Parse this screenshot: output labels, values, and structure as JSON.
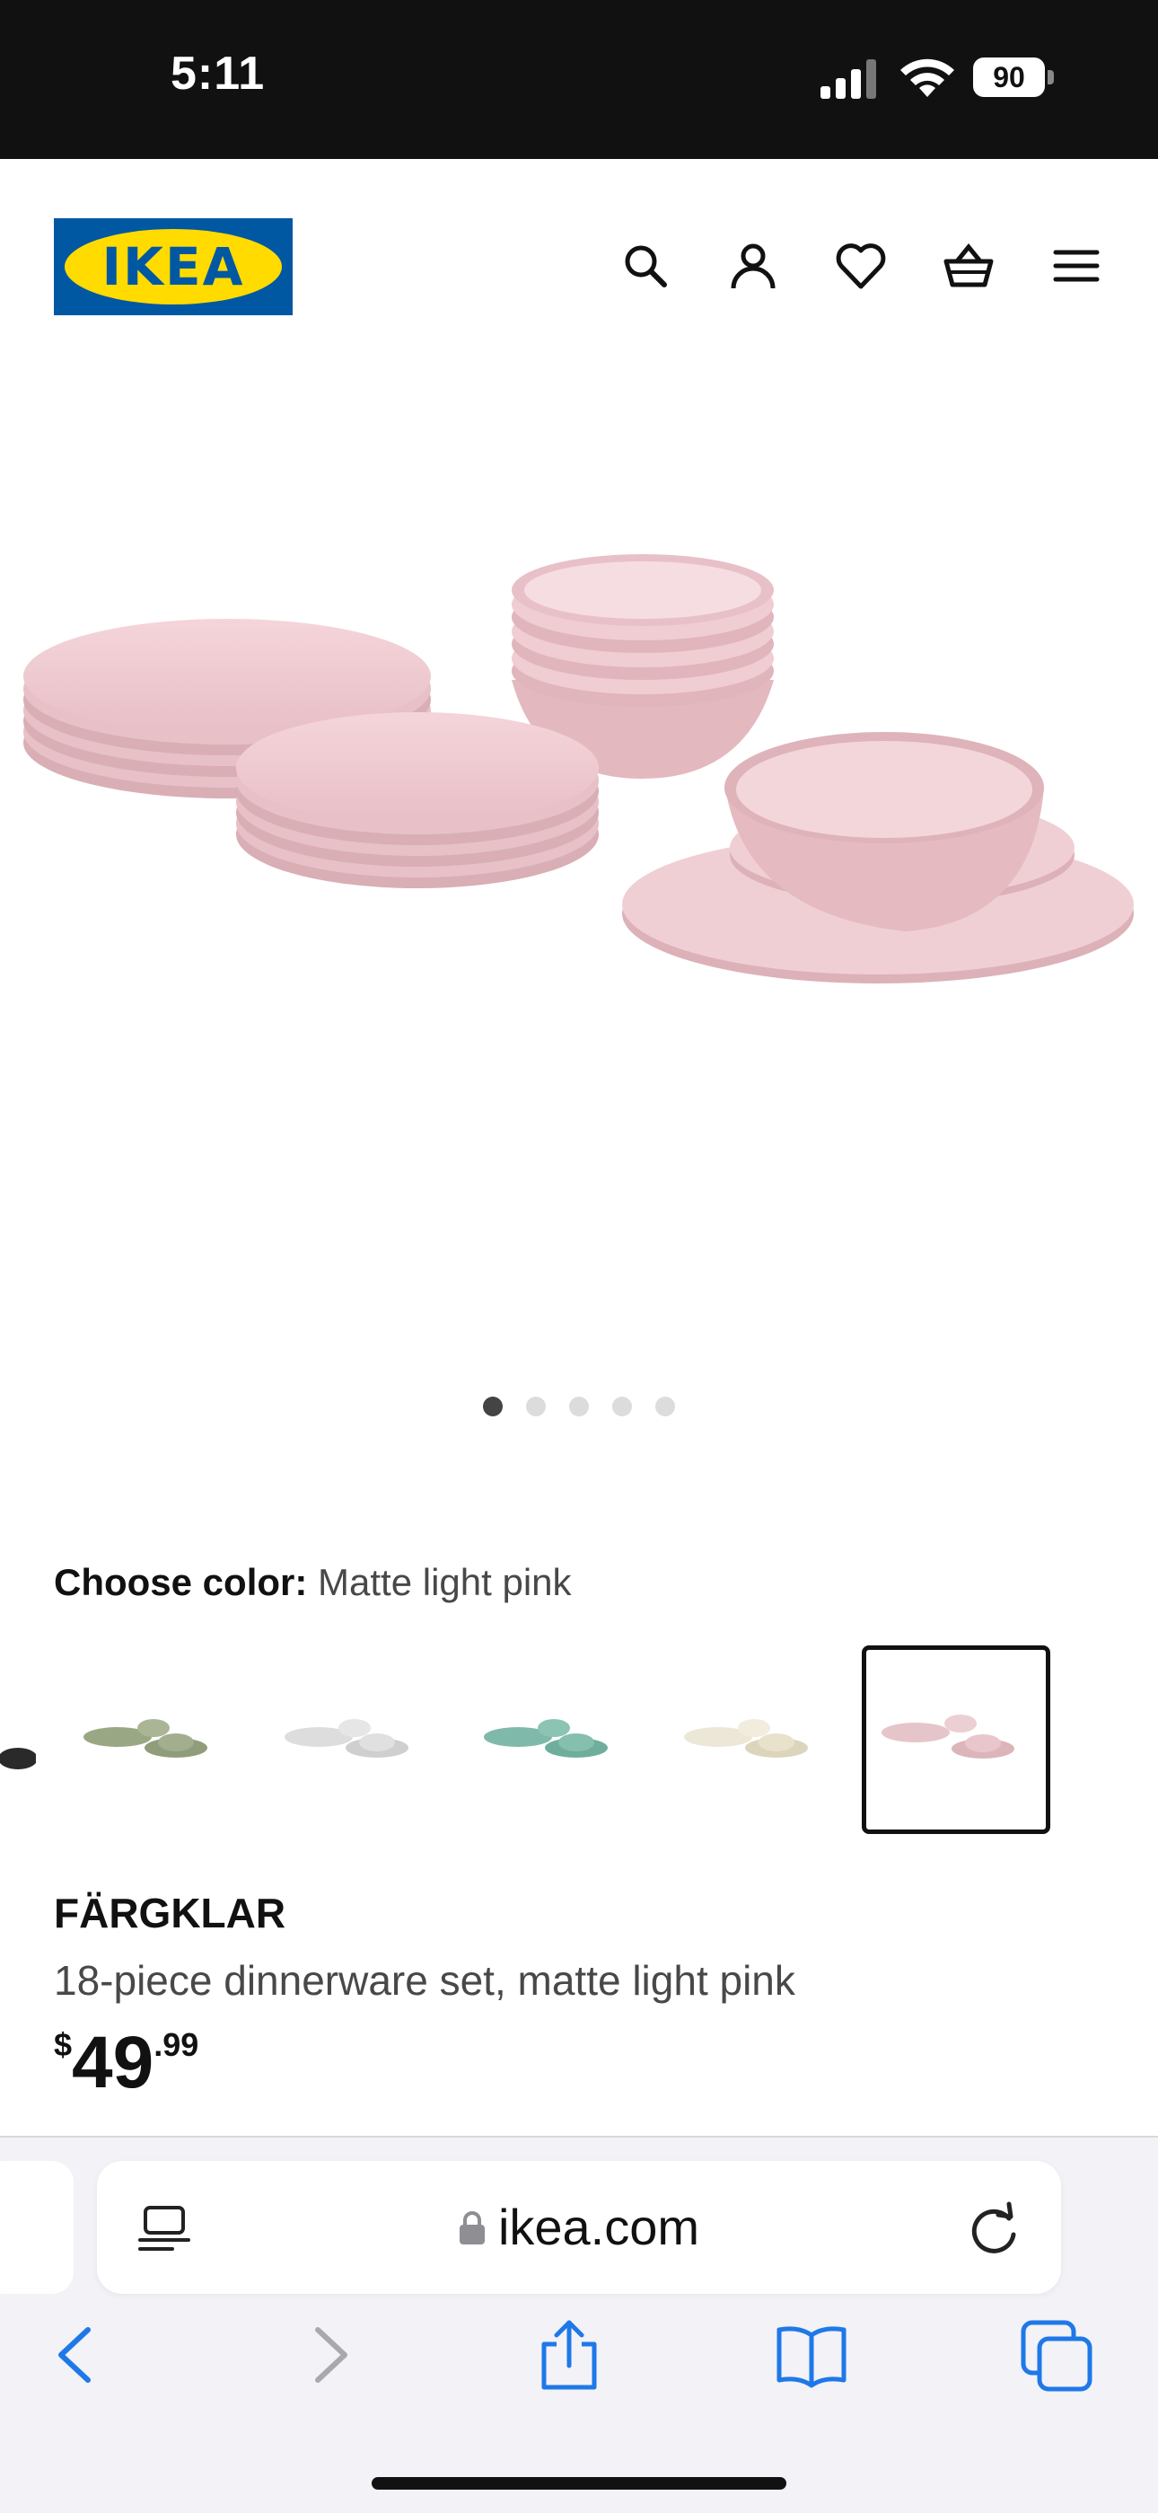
{
  "status_bar": {
    "time": "5:11",
    "battery": "90"
  },
  "header": {
    "logo_text": "IKEA"
  },
  "carousel": {
    "count": 5,
    "active": 0
  },
  "color_picker": {
    "label": "Choose color:",
    "selected": "Matte light pink"
  },
  "product": {
    "name": "FÄRGKLAR",
    "description": "18-piece dinnerware set, matte light pink",
    "price_currency": "$",
    "price_int": "49",
    "price_dec": ".99"
  },
  "browser": {
    "url": "ikea.com"
  },
  "colors": {
    "ikea_blue": "#0058a3",
    "ikea_yellow": "#ffdb00",
    "pink": "#efc9cf",
    "ios_blue": "#1f78e8"
  }
}
